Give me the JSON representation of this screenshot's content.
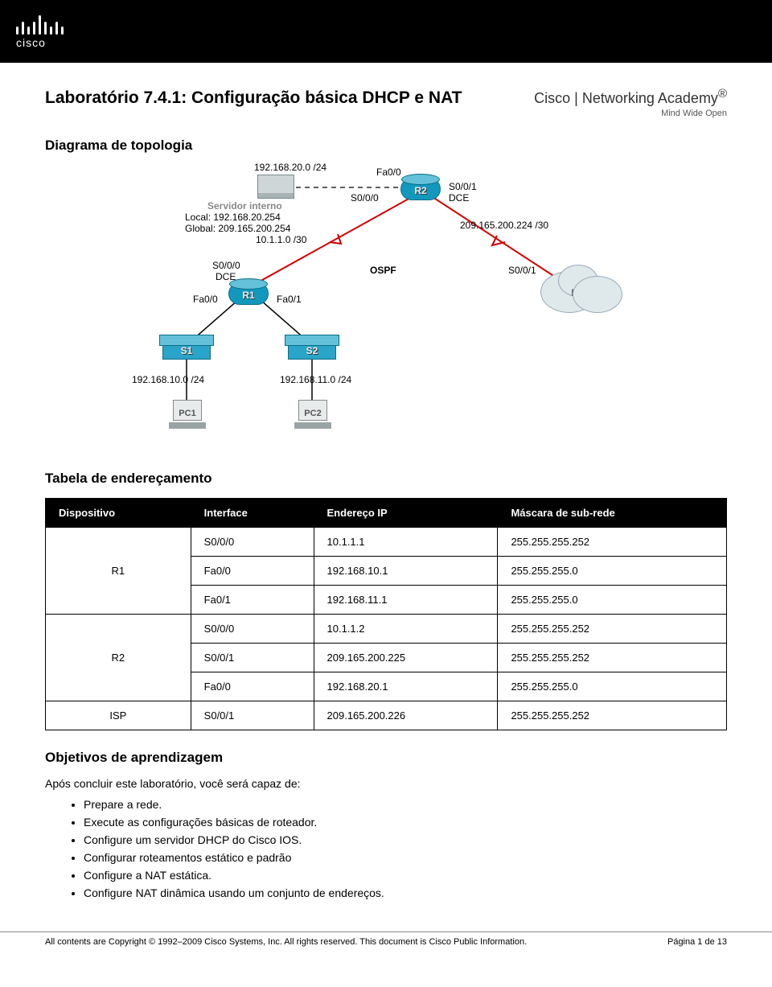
{
  "logo_word": "cisco",
  "academy": {
    "line1": "Cisco | Networking Academy",
    "line2": "Mind Wide Open",
    "tm": "®"
  },
  "title": "Laboratório 7.4.1: Configuração básica DHCP e NAT",
  "topology_heading": "Diagrama de topologia",
  "topo": {
    "server_label": "Servidor interno",
    "server_net": "192.168.20.0 /24",
    "server_local": "Local:  192.168.20.254",
    "server_global": "Global: 209.165.200.254",
    "loopback": "10.1.1.0 /30",
    "r2_fa00": "Fa0/0",
    "r2_s000": "S0/0/0",
    "r2_s001": "S0/0/1",
    "dce": "DCE",
    "right_net": "209.165.200.224 /30",
    "ospf": "OSPF",
    "r1_s000": "S0/0/0",
    "r1_s000_dce": "DCE",
    "isp_s001": "S0/0/1",
    "r1_fa00": "Fa0/0",
    "r1_fa01": "Fa0/1",
    "r1": "R1",
    "r2": "R2",
    "isp": "ISP",
    "s1": "S1",
    "s2": "S2",
    "pc1": "PC1",
    "pc2": "PC2",
    "net_pc1": "192.168.10.0 /24",
    "net_pc2": "192.168.11.0 /24"
  },
  "table_heading": "Tabela de endereçamento",
  "table": {
    "headers": [
      "Dispositivo",
      "Interface",
      "Endereço IP",
      "Máscara de sub-rede"
    ],
    "rows": [
      {
        "dev": "R1",
        "iface": "S0/0/0",
        "ip": "10.1.1.1",
        "mask": "255.255.255.252"
      },
      {
        "dev": "",
        "iface": "Fa0/0",
        "ip": "192.168.10.1",
        "mask": "255.255.255.0"
      },
      {
        "dev": "",
        "iface": "Fa0/1",
        "ip": "192.168.11.1",
        "mask": "255.255.255.0"
      },
      {
        "dev": "R2",
        "iface": "S0/0/0",
        "ip": "10.1.1.2",
        "mask": "255.255.255.252"
      },
      {
        "dev": "",
        "iface": "S0/0/1",
        "ip": "209.165.200.225",
        "mask": "255.255.255.252"
      },
      {
        "dev": "",
        "iface": "Fa0/0",
        "ip": "192.168.20.1",
        "mask": "255.255.255.0"
      },
      {
        "dev": "ISP",
        "iface": "S0/0/1",
        "ip": "209.165.200.226",
        "mask": "255.255.255.252"
      }
    ]
  },
  "objectives_heading": "Objetivos de aprendizagem",
  "objectives_intro": "Após concluir este laboratório, você será capaz de:",
  "objectives": [
    "Prepare a rede.",
    "Execute as configurações básicas de roteador.",
    "Configure um servidor DHCP do Cisco IOS.",
    "Configurar roteamentos estático e padrão",
    "Configure a NAT estática.",
    "Configure NAT dinâmica usando um conjunto de endereços."
  ],
  "footer": {
    "left": "All contents are Copyright © 1992–2009 Cisco Systems, Inc. All rights reserved. This document is Cisco Public Information.",
    "right": "Página 1 de 13"
  }
}
